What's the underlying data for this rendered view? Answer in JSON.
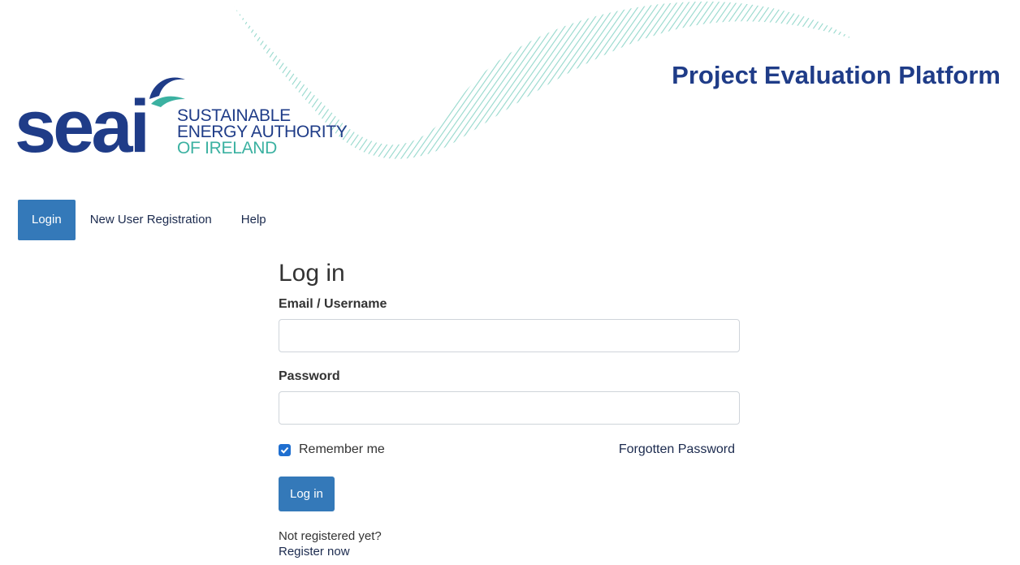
{
  "logo": {
    "mark": "seai",
    "line1": "SUSTAINABLE",
    "line2": "ENERGY AUTHORITY",
    "line3": "OF IRELAND"
  },
  "header": {
    "platform_title": "Project Evaluation Platform"
  },
  "nav": {
    "items": [
      {
        "label": "Login",
        "active": true
      },
      {
        "label": "New User Registration",
        "active": false
      },
      {
        "label": "Help",
        "active": false
      }
    ]
  },
  "form": {
    "title": "Log in",
    "email_label": "Email / Username",
    "email_value": "",
    "password_label": "Password",
    "password_value": "",
    "remember_label": "Remember me",
    "remember_checked": true,
    "forgot_link": "Forgotten Password",
    "submit_label": "Log in",
    "not_registered_text": "Not registered yet?",
    "register_link": "Register now"
  },
  "colors": {
    "brand_navy": "#1f3c88",
    "brand_teal": "#3bb1a1",
    "button_blue": "#3479b9",
    "checkbox_blue": "#1f6fd0"
  }
}
